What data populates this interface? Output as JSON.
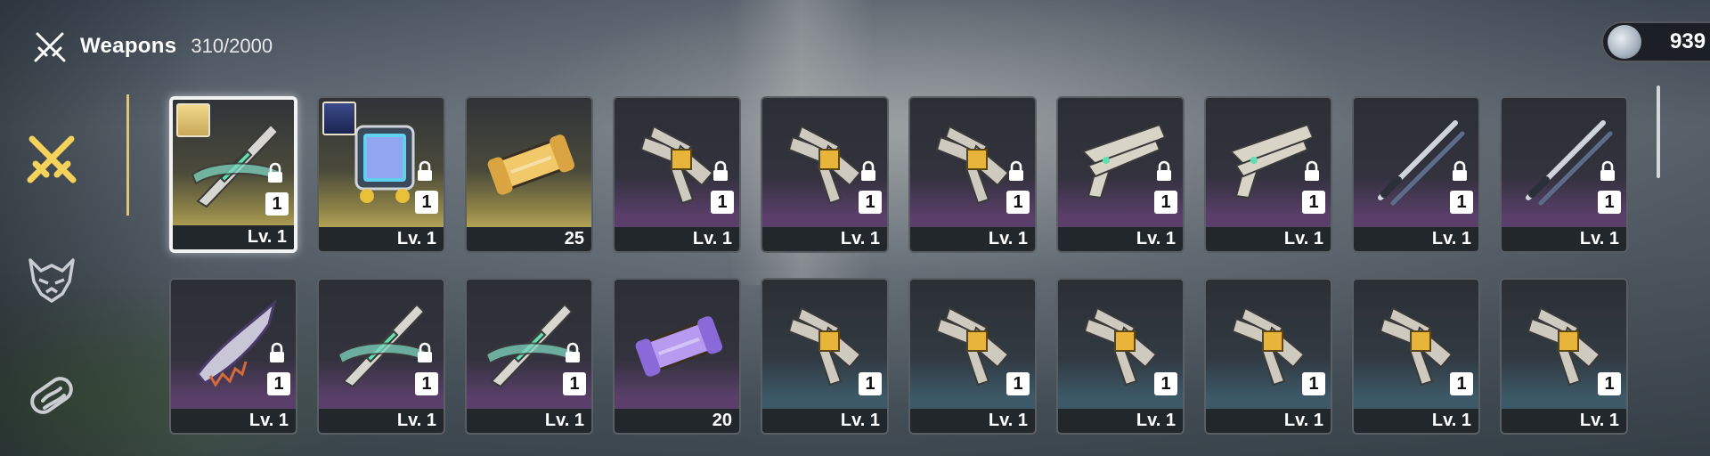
{
  "header": {
    "title": "Weapons",
    "count": "310/2000",
    "icon": "crossed-swords-icon"
  },
  "currency": {
    "icon": "shell-coin-icon",
    "value": "939"
  },
  "sidebar": {
    "tabs": [
      {
        "name": "weapons",
        "icon": "crossed-swords-icon",
        "active": true
      },
      {
        "name": "echoes",
        "icon": "demon-mask-icon",
        "active": false
      },
      {
        "name": "materials",
        "icon": "capsule-icon",
        "active": false
      }
    ]
  },
  "colors": {
    "gold": "#e8d06a",
    "purple": "#d58ef0",
    "blue": "#8fd0ea",
    "accent": "#f5d35a"
  },
  "items": [
    {
      "label": "Lv. 1",
      "qty": "1",
      "rarity": "gold",
      "locked": true,
      "avatar": true,
      "selected": true,
      "icon": "broadblade-weapon-icon"
    },
    {
      "label": "Lv. 1",
      "qty": "1",
      "rarity": "gold",
      "locked": true,
      "avatar": true,
      "selected": false,
      "icon": "rectifier-weapon-icon"
    },
    {
      "label": "25",
      "qty": "",
      "rarity": "gold",
      "locked": false,
      "avatar": false,
      "selected": false,
      "icon": "gold-energy-core-icon"
    },
    {
      "label": "Lv. 1",
      "qty": "1",
      "rarity": "purple",
      "locked": true,
      "avatar": false,
      "selected": false,
      "icon": "gauntlet-weapon-icon"
    },
    {
      "label": "Lv. 1",
      "qty": "1",
      "rarity": "purple",
      "locked": true,
      "avatar": false,
      "selected": false,
      "icon": "gauntlet-weapon-icon"
    },
    {
      "label": "Lv. 1",
      "qty": "1",
      "rarity": "purple",
      "locked": true,
      "avatar": false,
      "selected": false,
      "icon": "gauntlet-weapon-icon"
    },
    {
      "label": "Lv. 1",
      "qty": "1",
      "rarity": "purple",
      "locked": true,
      "avatar": false,
      "selected": false,
      "icon": "pistols-weapon-icon"
    },
    {
      "label": "Lv. 1",
      "qty": "1",
      "rarity": "purple",
      "locked": true,
      "avatar": false,
      "selected": false,
      "icon": "pistols-weapon-icon"
    },
    {
      "label": "Lv. 1",
      "qty": "1",
      "rarity": "purple",
      "locked": true,
      "avatar": false,
      "selected": false,
      "icon": "sword-weapon-icon"
    },
    {
      "label": "Lv. 1",
      "qty": "1",
      "rarity": "purple",
      "locked": true,
      "avatar": false,
      "selected": false,
      "icon": "sword-weapon-icon"
    },
    {
      "label": "Lv. 1",
      "qty": "1",
      "rarity": "purple",
      "locked": true,
      "avatar": false,
      "selected": false,
      "icon": "serrated-blade-weapon-icon"
    },
    {
      "label": "Lv. 1",
      "qty": "1",
      "rarity": "purple",
      "locked": true,
      "avatar": false,
      "selected": false,
      "icon": "broadblade-weapon-icon"
    },
    {
      "label": "Lv. 1",
      "qty": "1",
      "rarity": "purple",
      "locked": true,
      "avatar": false,
      "selected": false,
      "icon": "broadblade-weapon-icon"
    },
    {
      "label": "20",
      "qty": "",
      "rarity": "purple",
      "locked": false,
      "avatar": false,
      "selected": false,
      "icon": "purple-energy-core-icon"
    },
    {
      "label": "Lv. 1",
      "qty": "1",
      "rarity": "blue",
      "locked": false,
      "avatar": false,
      "selected": false,
      "icon": "gauntlet-weapon-icon"
    },
    {
      "label": "Lv. 1",
      "qty": "1",
      "rarity": "blue",
      "locked": false,
      "avatar": false,
      "selected": false,
      "icon": "gauntlet-weapon-icon"
    },
    {
      "label": "Lv. 1",
      "qty": "1",
      "rarity": "blue",
      "locked": false,
      "avatar": false,
      "selected": false,
      "icon": "gauntlet-weapon-icon"
    },
    {
      "label": "Lv. 1",
      "qty": "1",
      "rarity": "blue",
      "locked": false,
      "avatar": false,
      "selected": false,
      "icon": "gauntlet-weapon-icon"
    },
    {
      "label": "Lv. 1",
      "qty": "1",
      "rarity": "blue",
      "locked": false,
      "avatar": false,
      "selected": false,
      "icon": "gauntlet-weapon-icon"
    },
    {
      "label": "Lv. 1",
      "qty": "1",
      "rarity": "blue",
      "locked": false,
      "avatar": false,
      "selected": false,
      "icon": "gauntlet-weapon-icon"
    }
  ]
}
